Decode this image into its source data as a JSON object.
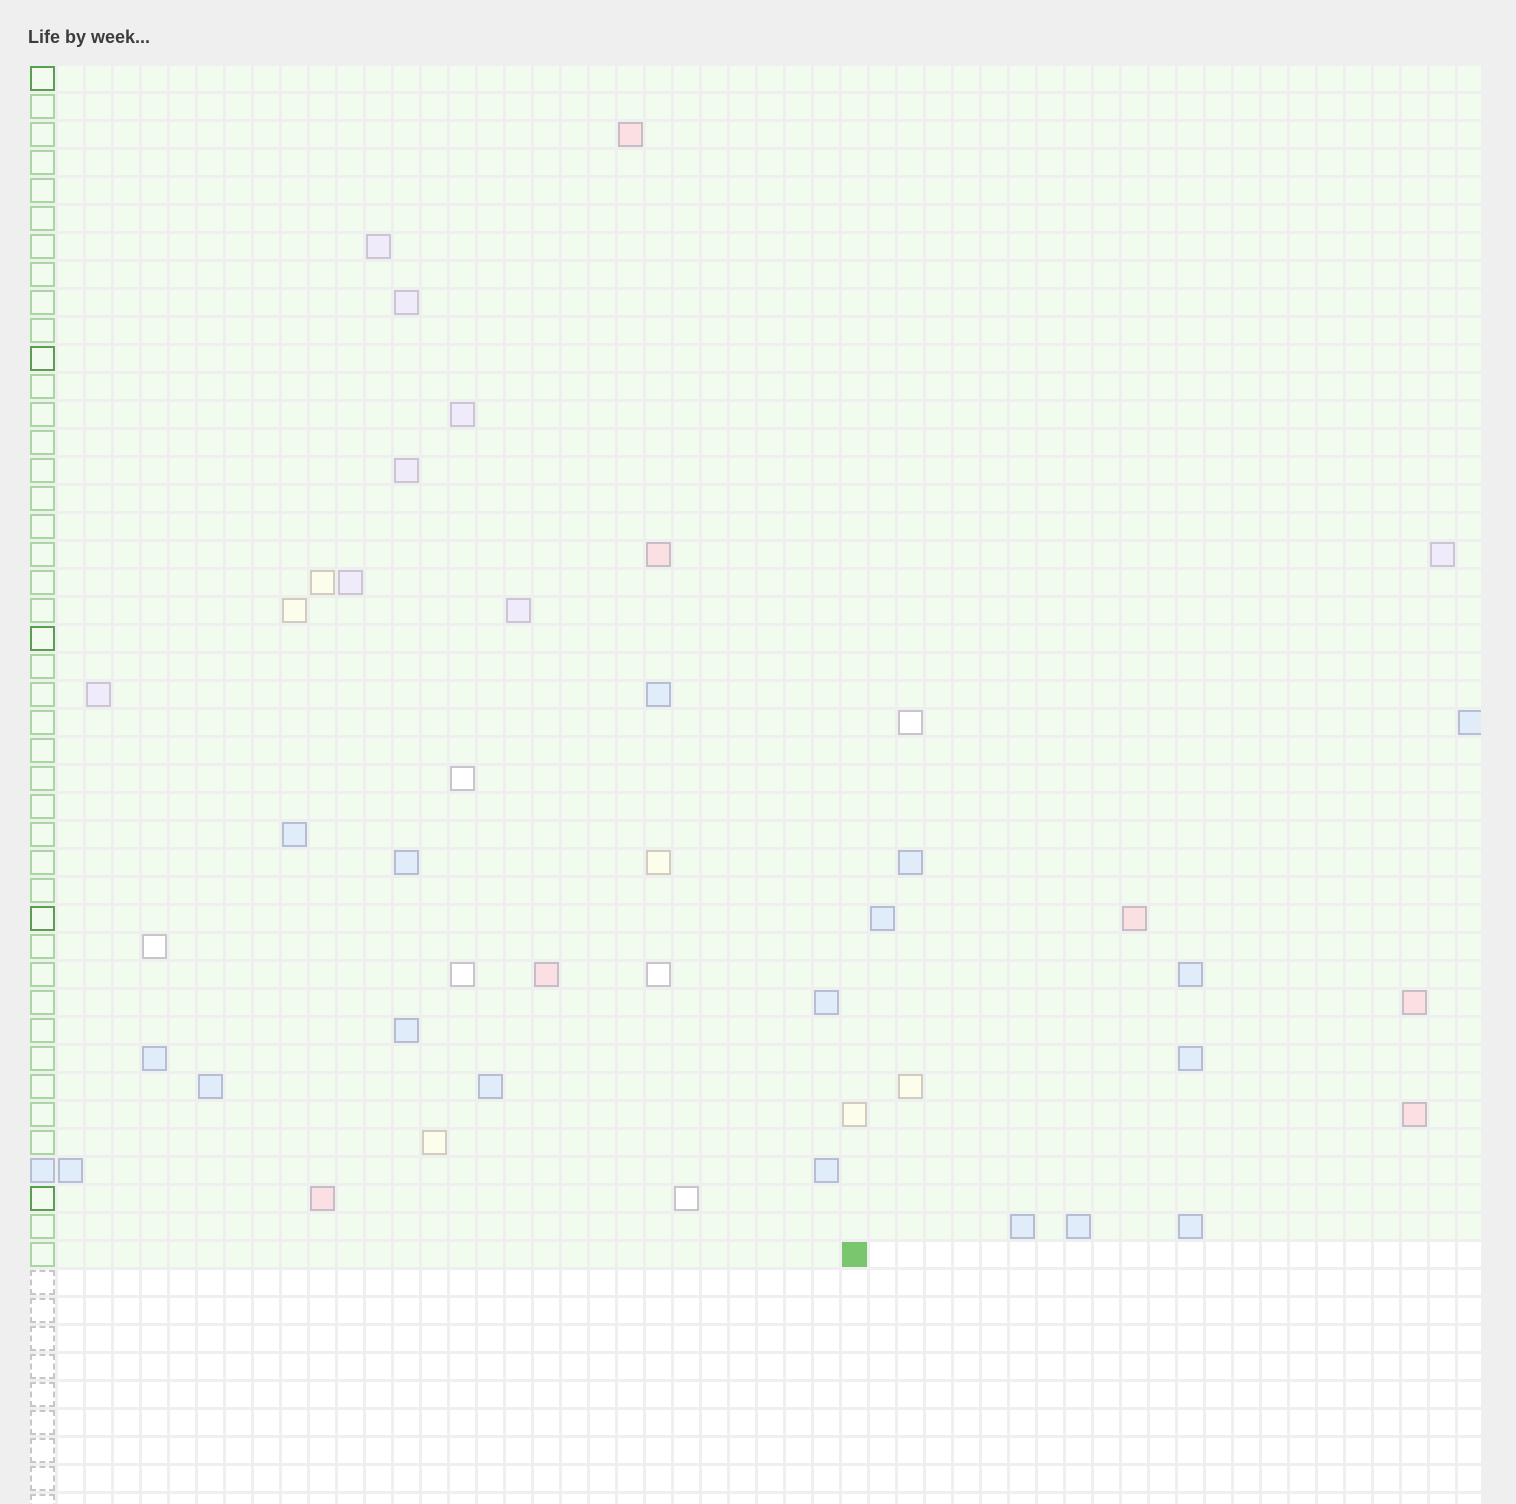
{
  "page": {
    "title": "Life by week..."
  },
  "grid": {
    "weeks_per_row": 52,
    "rows_visible": 52,
    "lived_full_rows": 42,
    "current_week": {
      "row": 42,
      "col": 29
    },
    "decade_marker_rows": [
      0,
      10,
      20,
      30,
      40
    ],
    "events": [
      {
        "row": 2,
        "col": 21,
        "kind": "pink"
      },
      {
        "row": 6,
        "col": 12,
        "kind": "lavender"
      },
      {
        "row": 8,
        "col": 13,
        "kind": "lavender"
      },
      {
        "row": 12,
        "col": 15,
        "kind": "lavender"
      },
      {
        "row": 14,
        "col": 13,
        "kind": "lavender"
      },
      {
        "row": 17,
        "col": 22,
        "kind": "pink"
      },
      {
        "row": 17,
        "col": 50,
        "kind": "lavender"
      },
      {
        "row": 18,
        "col": 10,
        "kind": "yellow"
      },
      {
        "row": 18,
        "col": 11,
        "kind": "lavender"
      },
      {
        "row": 19,
        "col": 9,
        "kind": "yellow"
      },
      {
        "row": 19,
        "col": 17,
        "kind": "lavender"
      },
      {
        "row": 22,
        "col": 2,
        "kind": "lavender"
      },
      {
        "row": 22,
        "col": 22,
        "kind": "blue"
      },
      {
        "row": 23,
        "col": 31,
        "kind": "white"
      },
      {
        "row": 23,
        "col": 51,
        "kind": "blue"
      },
      {
        "row": 25,
        "col": 15,
        "kind": "white"
      },
      {
        "row": 27,
        "col": 9,
        "kind": "blue"
      },
      {
        "row": 28,
        "col": 13,
        "kind": "blue"
      },
      {
        "row": 28,
        "col": 22,
        "kind": "yellow"
      },
      {
        "row": 28,
        "col": 31,
        "kind": "blue"
      },
      {
        "row": 30,
        "col": 30,
        "kind": "blue"
      },
      {
        "row": 30,
        "col": 39,
        "kind": "pink"
      },
      {
        "row": 31,
        "col": 4,
        "kind": "white"
      },
      {
        "row": 32,
        "col": 15,
        "kind": "white"
      },
      {
        "row": 32,
        "col": 18,
        "kind": "pink"
      },
      {
        "row": 32,
        "col": 22,
        "kind": "white"
      },
      {
        "row": 32,
        "col": 41,
        "kind": "blue"
      },
      {
        "row": 33,
        "col": 28,
        "kind": "blue"
      },
      {
        "row": 33,
        "col": 49,
        "kind": "pink"
      },
      {
        "row": 34,
        "col": 13,
        "kind": "blue"
      },
      {
        "row": 35,
        "col": 4,
        "kind": "blue"
      },
      {
        "row": 35,
        "col": 41,
        "kind": "blue"
      },
      {
        "row": 36,
        "col": 6,
        "kind": "blue"
      },
      {
        "row": 36,
        "col": 16,
        "kind": "blue"
      },
      {
        "row": 36,
        "col": 31,
        "kind": "yellow"
      },
      {
        "row": 37,
        "col": 29,
        "kind": "yellow"
      },
      {
        "row": 37,
        "col": 49,
        "kind": "pink"
      },
      {
        "row": 38,
        "col": 14,
        "kind": "yellow"
      },
      {
        "row": 39,
        "col": 0,
        "kind": "blue"
      },
      {
        "row": 39,
        "col": 1,
        "kind": "blue"
      },
      {
        "row": 39,
        "col": 28,
        "kind": "blue"
      },
      {
        "row": 40,
        "col": 10,
        "kind": "pink"
      },
      {
        "row": 40,
        "col": 23,
        "kind": "white"
      },
      {
        "row": 41,
        "col": 35,
        "kind": "blue"
      },
      {
        "row": 41,
        "col": 37,
        "kind": "blue"
      },
      {
        "row": 41,
        "col": 41,
        "kind": "blue"
      }
    ]
  },
  "colors": {
    "lived": "#f1fbee",
    "future": "#ffffff",
    "current": "#7ac66e",
    "row_start_border": "#a9d7a2",
    "decade_border": "#5a9e50",
    "event_pink": "#fbe0e3",
    "event_lavender": "#efebfa",
    "event_blue": "#e1ecfb",
    "event_yellow": "#fdfdec",
    "event_white": "#ffffff",
    "page_background": "#efefef"
  }
}
